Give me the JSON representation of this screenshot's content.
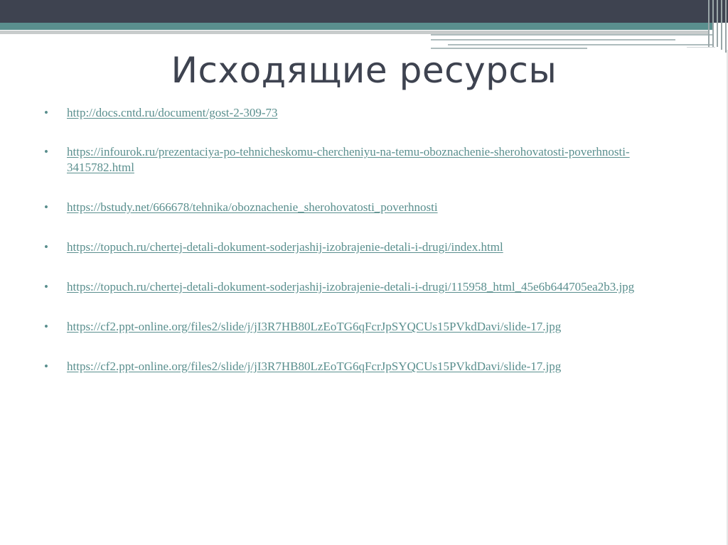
{
  "slide": {
    "title": "Исходящие ресурсы",
    "bullet_char": "•",
    "links": [
      "http://docs.cntd.ru/document/gost-2-309-73",
      "https://infourok.ru/prezentaciya-po-tehnicheskomu-chercheniyu-na-temu-oboznachenie-sherohovatosti-poverhnosti-3415782.html",
      "https://bstudy.net/666678/tehnika/oboznachenie_sherohovatosti_poverhnosti",
      "https://topuch.ru/chertej-detali-dokument-soderjashij-izobrajenie-detali-i-drugi/index.html",
      "https://topuch.ru/chertej-detali-dokument-soderjashij-izobrajenie-detali-i-drugi/115958_html_45e6b644705ea2b3.jpg",
      "https://cf2.ppt-online.org/files2/slide/j/jI3R7HB80LzEoTG6qFcrJpSYQCUs15PVkdDavi/slide-17.jpg",
      "https://cf2.ppt-online.org/files2/slide/j/jI3R7HB80LzEoTG6qFcrJpSYQCUs15PVkdDavi/slide-17.jpg"
    ]
  },
  "colors": {
    "accent": "#5a8f8e",
    "title": "#3e4350",
    "top_bar": "#3e4350"
  }
}
